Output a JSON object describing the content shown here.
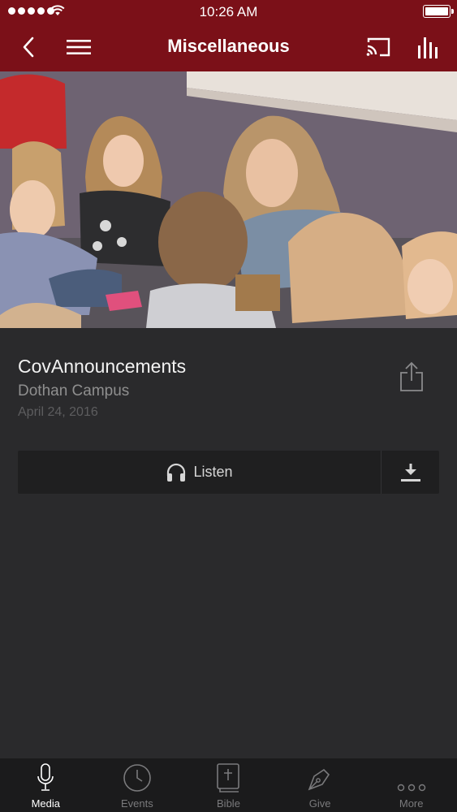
{
  "status_bar": {
    "time": "10:26 AM"
  },
  "nav": {
    "title": "Miscellaneous"
  },
  "media": {
    "title": "CovAnnouncements",
    "campus": "Dothan Campus",
    "date": "April 24, 2016"
  },
  "actions": {
    "listen_label": "Listen"
  },
  "tabs": [
    {
      "label": "Media",
      "icon": "microphone-icon"
    },
    {
      "label": "Events",
      "icon": "clock-icon"
    },
    {
      "label": "Bible",
      "icon": "bible-icon"
    },
    {
      "label": "Give",
      "icon": "pen-nib-icon"
    },
    {
      "label": "More",
      "icon": "more-dots-icon"
    }
  ],
  "colors": {
    "brand": "#7b1018",
    "background": "#2a2a2c",
    "tabbar": "#1b1b1c"
  }
}
